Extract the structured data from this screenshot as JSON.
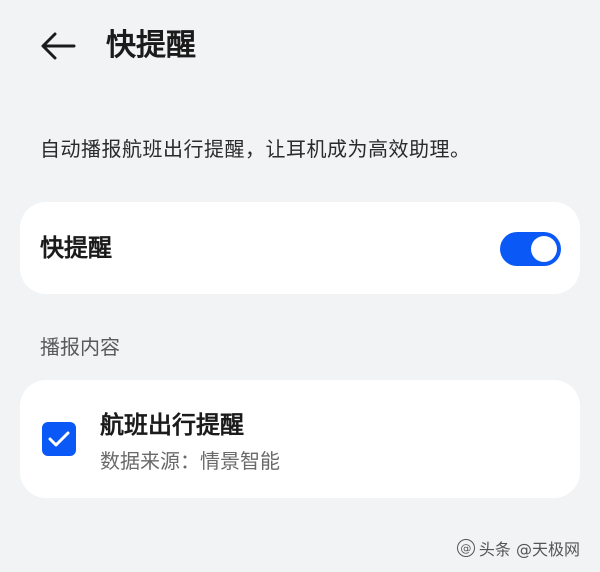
{
  "header": {
    "title": "快提醒",
    "back_icon": "arrow-left-icon"
  },
  "description": "自动播报航班出行提醒，让耳机成为高效助理。",
  "toggle_card": {
    "label": "快提醒",
    "enabled": true,
    "switch_color": "#0a59f7"
  },
  "section": {
    "title": "播报内容"
  },
  "content_items": [
    {
      "title": "航班出行提醒",
      "subtitle": "数据来源：情景智能",
      "checked": true
    }
  ],
  "watermark": {
    "icon_text": "@",
    "text": "头条 @天极网"
  },
  "colors": {
    "background": "#f1f3f5",
    "card": "#ffffff",
    "accent": "#0a59f7"
  }
}
